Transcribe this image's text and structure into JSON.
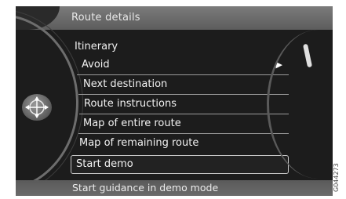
{
  "header": {
    "breadcrumb": "Route details"
  },
  "menu": {
    "title": "Itinerary",
    "items": [
      {
        "label": "Avoid",
        "has_submenu": true
      },
      {
        "label": "Next destination",
        "has_submenu": false
      },
      {
        "label": "Route instructions",
        "has_submenu": false
      },
      {
        "label": "Map of entire route",
        "has_submenu": false
      },
      {
        "label": "Map of remaining route",
        "has_submenu": false
      },
      {
        "label": "Start demo",
        "has_submenu": false,
        "selected": true
      }
    ],
    "submenu_arrow": "▶"
  },
  "status_bar": {
    "text": "Start guidance in demo mode"
  },
  "nav_knob_icon": "navigation-compass-icon",
  "figure_code": "G044273",
  "colors": {
    "screen_bg": "#1c1c1c",
    "bar_bg": "#6b6b6b",
    "text": "#f2f2f2",
    "divider": "#9a9a9a"
  }
}
